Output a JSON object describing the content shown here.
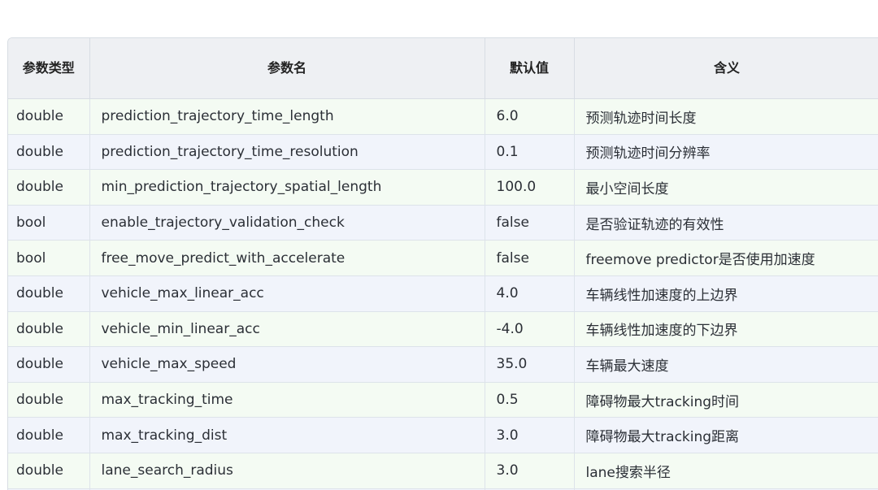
{
  "table": {
    "headers": {
      "type": "参数类型",
      "name": "参数名",
      "default": "默认值",
      "meaning": "含义"
    },
    "rows": [
      {
        "type": "double",
        "name": "prediction_trajectory_time_length",
        "default": "6.0",
        "meaning": "预测轨迹时间长度"
      },
      {
        "type": "double",
        "name": "prediction_trajectory_time_resolution",
        "default": "0.1",
        "meaning": "预测轨迹时间分辨率"
      },
      {
        "type": "double",
        "name": "min_prediction_trajectory_spatial_length",
        "default": "100.0",
        "meaning": "最小空间长度"
      },
      {
        "type": "bool",
        "name": "enable_trajectory_validation_check",
        "default": "false",
        "meaning": "是否验证轨迹的有效性"
      },
      {
        "type": "bool",
        "name": "free_move_predict_with_accelerate",
        "default": "false",
        "meaning": "freemove predictor是否使用加速度"
      },
      {
        "type": "double",
        "name": "vehicle_max_linear_acc",
        "default": "4.0",
        "meaning": "车辆线性加速度的上边界"
      },
      {
        "type": "double",
        "name": "vehicle_min_linear_acc",
        "default": "-4.0",
        "meaning": "车辆线性加速度的下边界"
      },
      {
        "type": "double",
        "name": "vehicle_max_speed",
        "default": "35.0",
        "meaning": "车辆最大速度"
      },
      {
        "type": "double",
        "name": "max_tracking_time",
        "default": "0.5",
        "meaning": "障碍物最大tracking时间"
      },
      {
        "type": "double",
        "name": "max_tracking_dist",
        "default": "3.0",
        "meaning": "障碍物最大tracking距离"
      },
      {
        "type": "double",
        "name": "lane_search_radius",
        "default": "3.0",
        "meaning": "lane搜索半径"
      }
    ]
  }
}
